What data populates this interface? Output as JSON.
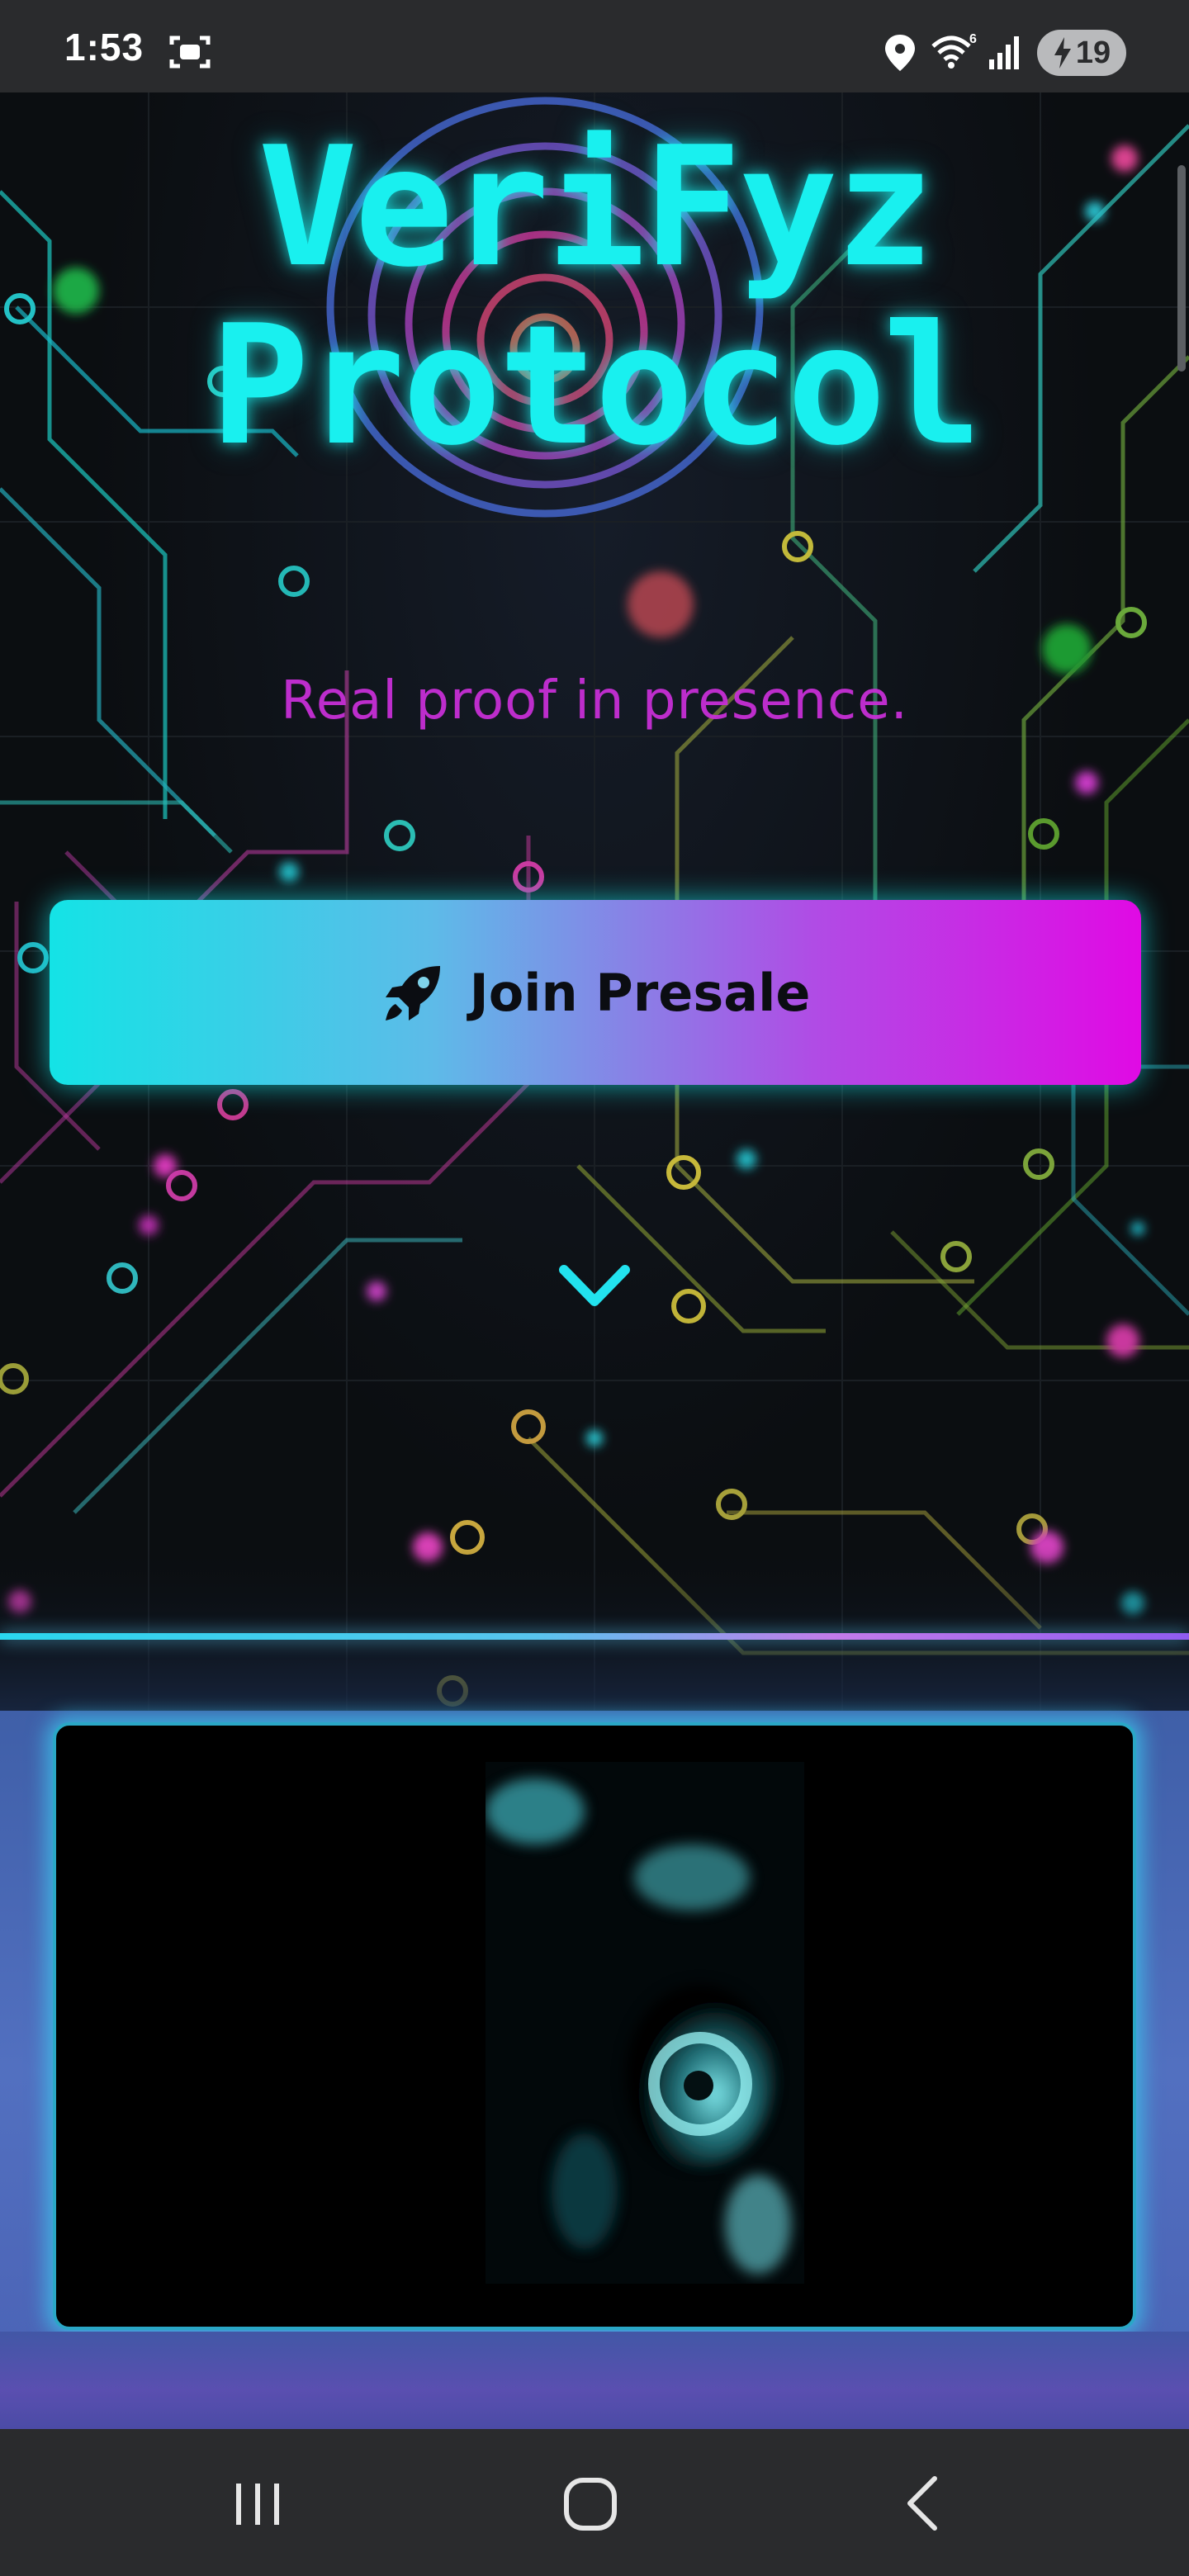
{
  "status_bar": {
    "time": "1:53",
    "battery_level": "19",
    "icons": [
      "screenshot-icon",
      "location-icon",
      "wifi-icon",
      "signal-icon",
      "battery-icon"
    ]
  },
  "hero": {
    "title": "VeriFyz Protocol",
    "tagline": "Real proof in presence.",
    "cta_label": "Join Presale",
    "cta_icon": "rocket-icon",
    "scroll_hint_icon": "chevron-down-icon"
  },
  "colors": {
    "title": "#19f0ef",
    "tagline": "#c72fd6",
    "button_gradient_start": "#14e3e6",
    "button_gradient_end": "#e00ae4"
  },
  "nav_bar": {
    "buttons": [
      "recent-apps-icon",
      "home-icon",
      "back-icon"
    ]
  }
}
